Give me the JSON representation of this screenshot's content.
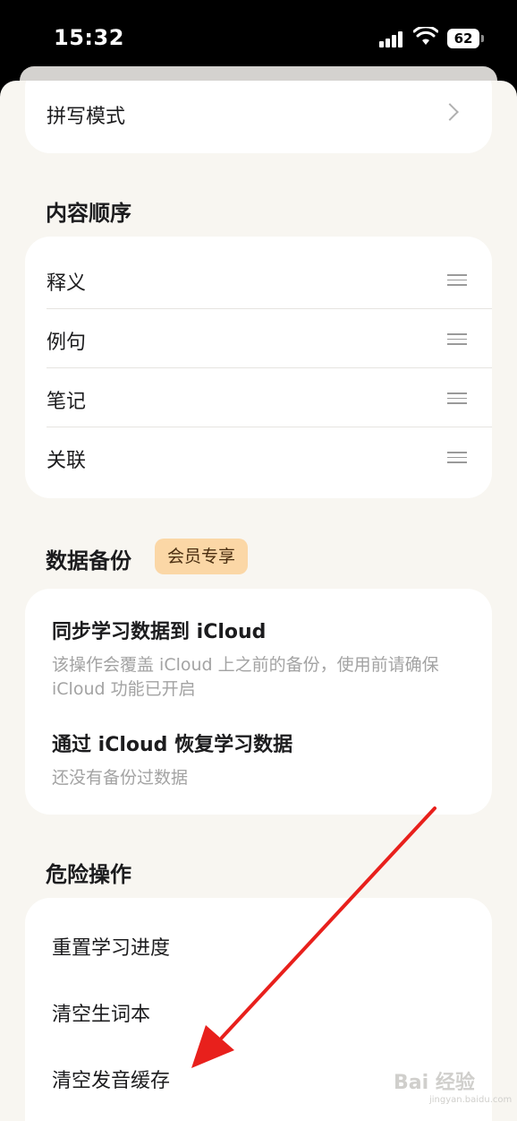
{
  "status": {
    "time": "15:32",
    "battery": "62"
  },
  "spell": {
    "label": "拼写模式"
  },
  "content_order": {
    "title": "内容顺序",
    "items": [
      "释义",
      "例句",
      "笔记",
      "关联"
    ]
  },
  "backup": {
    "title": "数据备份",
    "badge": "会员专享",
    "sync_title": "同步学习数据到 iCloud",
    "sync_desc": "该操作会覆盖 iCloud 上之前的备份，使用前请确保 iCloud 功能已开启",
    "restore_title": "通过 iCloud 恢复学习数据",
    "restore_desc": "还没有备份过数据"
  },
  "danger": {
    "title": "危险操作",
    "items": [
      "重置学习进度",
      "清空生词本",
      "清空发音缓存"
    ]
  },
  "watermark": {
    "text": "Bai 经验",
    "sub": "jingyan.baidu.com"
  },
  "colors": {
    "accent_badge": "#fbd7a6",
    "arrow": "#e8201c",
    "background": "#f8f6f1"
  }
}
